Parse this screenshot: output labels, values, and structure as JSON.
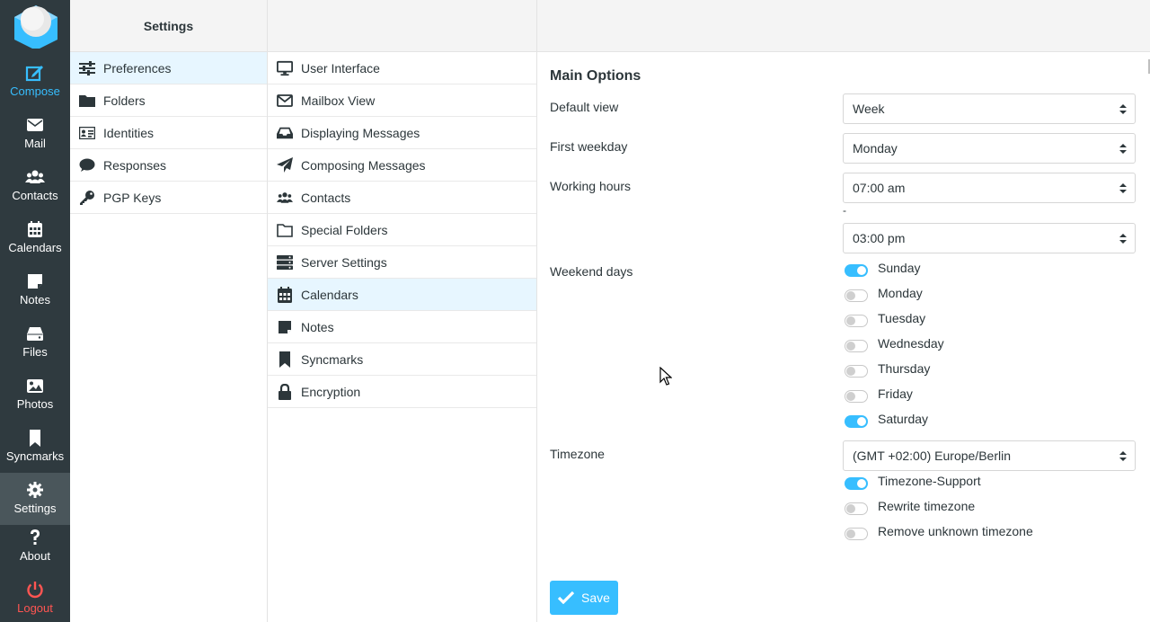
{
  "nav": {
    "items": [
      {
        "label": "Compose",
        "icon": "compose-icon"
      },
      {
        "label": "Mail",
        "icon": "mail-icon"
      },
      {
        "label": "Contacts",
        "icon": "contacts-icon"
      },
      {
        "label": "Calendars",
        "icon": "calendar-icon"
      },
      {
        "label": "Notes",
        "icon": "note-icon"
      },
      {
        "label": "Files",
        "icon": "drive-icon"
      },
      {
        "label": "Photos",
        "icon": "image-icon"
      },
      {
        "label": "Syncmarks",
        "icon": "bookmark-icon"
      },
      {
        "label": "Settings",
        "icon": "gear-icon"
      },
      {
        "label": "About",
        "icon": "question-icon"
      },
      {
        "label": "Logout",
        "icon": "power-icon"
      }
    ]
  },
  "sections": {
    "title": "Settings",
    "items": [
      {
        "label": "Preferences",
        "icon": "sliders-icon"
      },
      {
        "label": "Folders",
        "icon": "folder-icon"
      },
      {
        "label": "Identities",
        "icon": "id-card-icon"
      },
      {
        "label": "Responses",
        "icon": "comment-icon"
      },
      {
        "label": "PGP Keys",
        "icon": "key-icon"
      }
    ]
  },
  "preferences": {
    "items": [
      {
        "label": "User Interface",
        "icon": "monitor-icon"
      },
      {
        "label": "Mailbox View",
        "icon": "envelope-icon"
      },
      {
        "label": "Displaying Messages",
        "icon": "inbox-icon"
      },
      {
        "label": "Composing Messages",
        "icon": "paper-plane-icon"
      },
      {
        "label": "Contacts",
        "icon": "users-icon"
      },
      {
        "label": "Special Folders",
        "icon": "folder-outline-icon"
      },
      {
        "label": "Server Settings",
        "icon": "server-icon"
      },
      {
        "label": "Calendars",
        "icon": "calendar-icon"
      },
      {
        "label": "Notes",
        "icon": "note-icon"
      },
      {
        "label": "Syncmarks",
        "icon": "bookmark-icon"
      },
      {
        "label": "Encryption",
        "icon": "lock-icon"
      }
    ]
  },
  "main": {
    "title": "Main Options",
    "default_view": {
      "label": "Default view",
      "value": "Week"
    },
    "first_weekday": {
      "label": "First weekday",
      "value": "Monday"
    },
    "working_hours": {
      "label": "Working hours",
      "start": "07:00 am",
      "separator": "-",
      "end": "03:00 pm"
    },
    "weekend_days": {
      "label": "Weekend days",
      "days": [
        {
          "label": "Sunday",
          "on": true
        },
        {
          "label": "Monday",
          "on": false
        },
        {
          "label": "Tuesday",
          "on": false
        },
        {
          "label": "Wednesday",
          "on": false
        },
        {
          "label": "Thursday",
          "on": false
        },
        {
          "label": "Friday",
          "on": false
        },
        {
          "label": "Saturday",
          "on": true
        }
      ]
    },
    "timezone": {
      "label": "Timezone",
      "value": "(GMT +02:00) Europe/Berlin",
      "options": [
        {
          "label": "Timezone-Support",
          "on": true
        },
        {
          "label": "Rewrite timezone",
          "on": false
        },
        {
          "label": "Remove unknown timezone",
          "on": false
        }
      ]
    },
    "save_label": "Save"
  },
  "colors": {
    "nav_bg": "#2f3a3f",
    "accent": "#37beff",
    "logout": "#ff5552",
    "selected_bg": "#e7f6ff"
  }
}
